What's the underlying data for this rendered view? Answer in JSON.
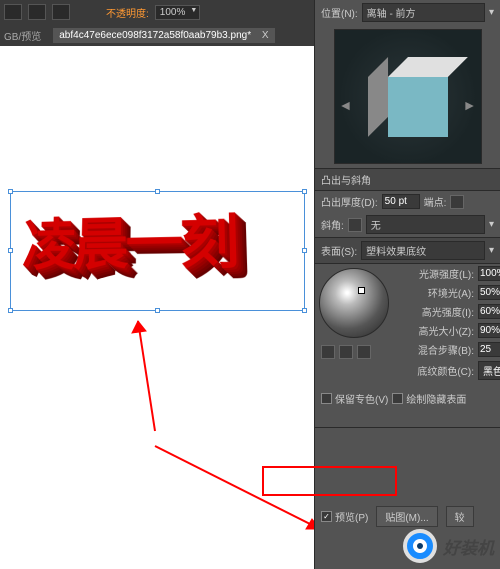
{
  "toolbar": {
    "opacity_label": "不透明度:",
    "opacity_value": "100%"
  },
  "tabs": {
    "mode": "GB/预览",
    "filename": "abf4c47e6ece098f3172a58f0aab79b3.png*",
    "close": "X"
  },
  "canvas": {
    "text_3d": "凌晨一刻"
  },
  "panel": {
    "position_label": "位置(N):",
    "position_value": "离轴 - 前方",
    "extrude_section": "凸出与斜角",
    "depth_label": "凸出厚度(D):",
    "depth_value": "50 pt",
    "cap_label": "端点:",
    "bevel_label": "斜角:",
    "bevel_value": "无",
    "surface_label": "表面(S):",
    "surface_value": "塑料效果底纹",
    "light_intensity_label": "光源强度(L):",
    "light_intensity_value": "100%",
    "ambient_label": "环境光(A):",
    "ambient_value": "50%",
    "highlight_intensity_label": "高光强度(I):",
    "highlight_intensity_value": "60%",
    "highlight_size_label": "高光大小(Z):",
    "highlight_size_value": "90%",
    "blend_steps_label": "混合步骤(B):",
    "blend_steps_value": "25",
    "shade_color_label": "底纹颜色(C):",
    "shade_color_value": "黑色",
    "preserve_spot_label": "保留专色(V)",
    "draw_hidden_label": "绘制隐藏表面",
    "preview_label": "预览(P)",
    "map_btn": "贴图(M)...",
    "more_btn": "较"
  },
  "watermark": {
    "text": "好装机"
  }
}
